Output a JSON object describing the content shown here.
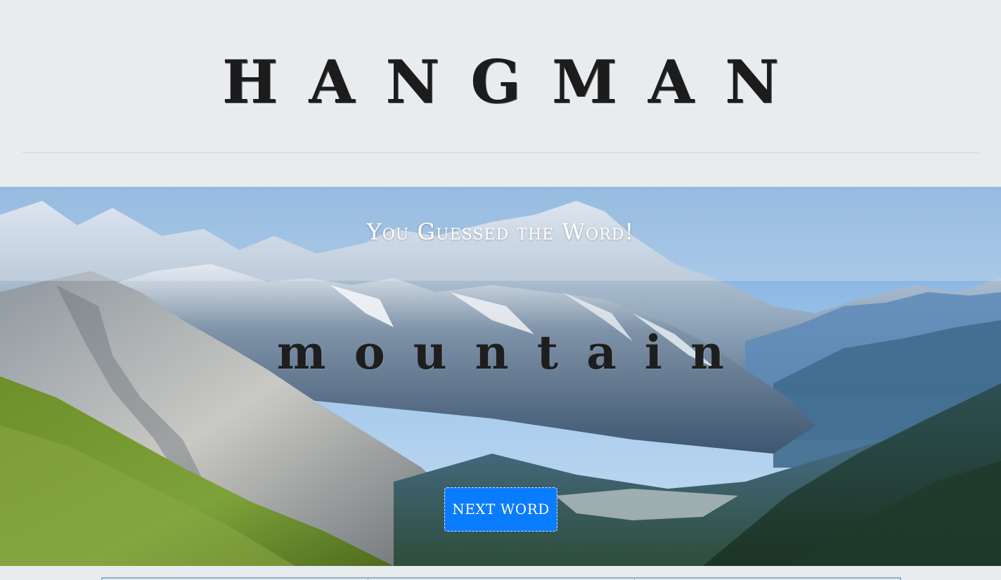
{
  "header": {
    "title": "HANGMAN"
  },
  "game": {
    "message": "You Guessed the Word!",
    "word": "mountain",
    "next_button_label": "NEXT WORD"
  },
  "theme": {
    "background": "#e8ecef",
    "button_color": "#0a7cff",
    "title_color": "#1c1c1c"
  },
  "letter_table": {
    "columns": 3
  }
}
